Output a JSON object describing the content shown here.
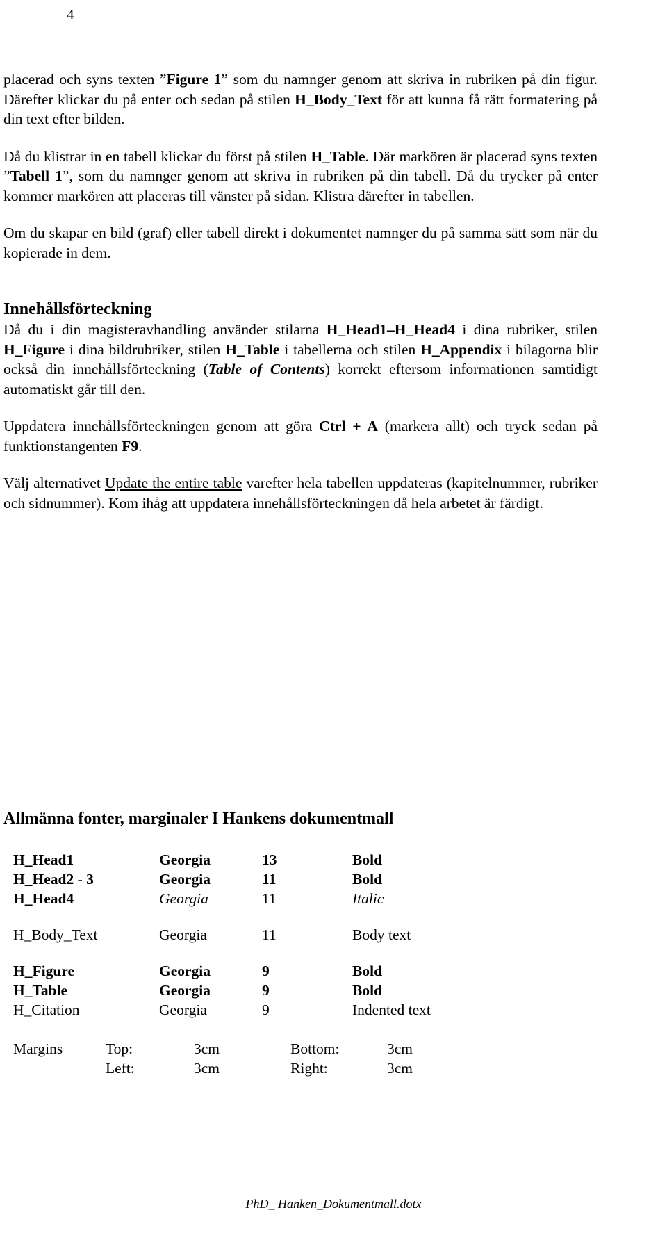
{
  "page": {
    "number": "4",
    "footer": "PhD_ Hanken_Dokumentmall.dotx"
  },
  "paragraphs": {
    "p1_a": "placerad och syns texten ",
    "p1_b": "Figure 1",
    "p1_c": " som du namnger genom att skriva in rubriken på din figur. Därefter klickar du på enter och sedan på stilen ",
    "p1_d": "H_Body_Text",
    "p1_e": " för att kunna få rätt formatering på din text efter bilden.",
    "p2_a": "Då du klistrar in en tabell klickar du först på stilen ",
    "p2_b": "H_Table",
    "p2_c": ". Där markören är placerad syns texten ",
    "p2_d": "Tabell 1",
    "p2_e": ", som du namnger genom att skriva in rubriken på din tabell. Då du trycker på enter kommer markören att placeras till vänster på sidan. Klistra därefter in tabellen.",
    "p3": "Om du skapar en bild (graf) eller tabell direkt i dokumentet namnger du på samma sätt som när du kopierade in dem.",
    "heading_toc": "Innehållsförteckning",
    "p4_a": "Då du i din magisteravhandling använder stilarna ",
    "p4_b": "H_Head1",
    "p4_c": "–",
    "p4_d": "H_Head4",
    "p4_e": " i dina rubriker, stilen ",
    "p4_f": "H_Figure",
    "p4_g": " i dina bildrubriker, stilen ",
    "p4_h": "H_Table",
    "p4_i": " i tabellerna och stilen ",
    "p4_j": "H_Appendix",
    "p4_k": " i bilagorna blir också din innehållsförteckning (",
    "p4_l": "Table of Contents",
    "p4_m": ") korrekt eftersom informationen samtidigt automatiskt går till den.",
    "p5_a": "Uppdatera innehållsförteckningen genom att göra ",
    "p5_b": "Ctrl + A",
    "p5_c": " (markera allt) och tryck sedan på funktionstangenten ",
    "p5_d": "F9",
    "p5_e": ".",
    "p6_a": "Välj alternativet ",
    "p6_b": "Update the entire table",
    "p6_c": " varefter hela tabellen uppdateras (kapitelnummer, rubriker och sidnummer). Kom ihåg att uppdatera innehållsförteckningen då hela arbetet är färdigt."
  },
  "styles_section": {
    "heading": "Allmänna fonter, marginaler I Hankens dokumentmall",
    "rows": [
      {
        "name": "H_Head1",
        "font": "Georgia",
        "size": "13",
        "note": "Bold"
      },
      {
        "name": "H_Head2 - 3",
        "font": "Georgia",
        "size": "11",
        "note": "Bold"
      },
      {
        "name": "H_Head4",
        "font": "Georgia",
        "size": "11",
        "note": "Italic"
      },
      {
        "name": "H_Body_Text",
        "font": "Georgia",
        "size": "11",
        "note": "Body text"
      },
      {
        "name": "H_Figure",
        "font": "Georgia",
        "size": "9",
        "note": "Bold"
      },
      {
        "name": "H_Table",
        "font": "Georgia",
        "size": "9",
        "note": "Bold"
      },
      {
        "name": "H_Citation",
        "font": "Georgia",
        "size": "9",
        "note": "Indented text"
      }
    ],
    "margins": {
      "label": "Margins",
      "top_label": "Top:",
      "top_value": "3cm",
      "bottom_label": "Bottom:",
      "bottom_value": "3cm",
      "left_label": "Left:",
      "left_value": "3cm",
      "right_label": "Right:",
      "right_value": "3cm"
    }
  }
}
